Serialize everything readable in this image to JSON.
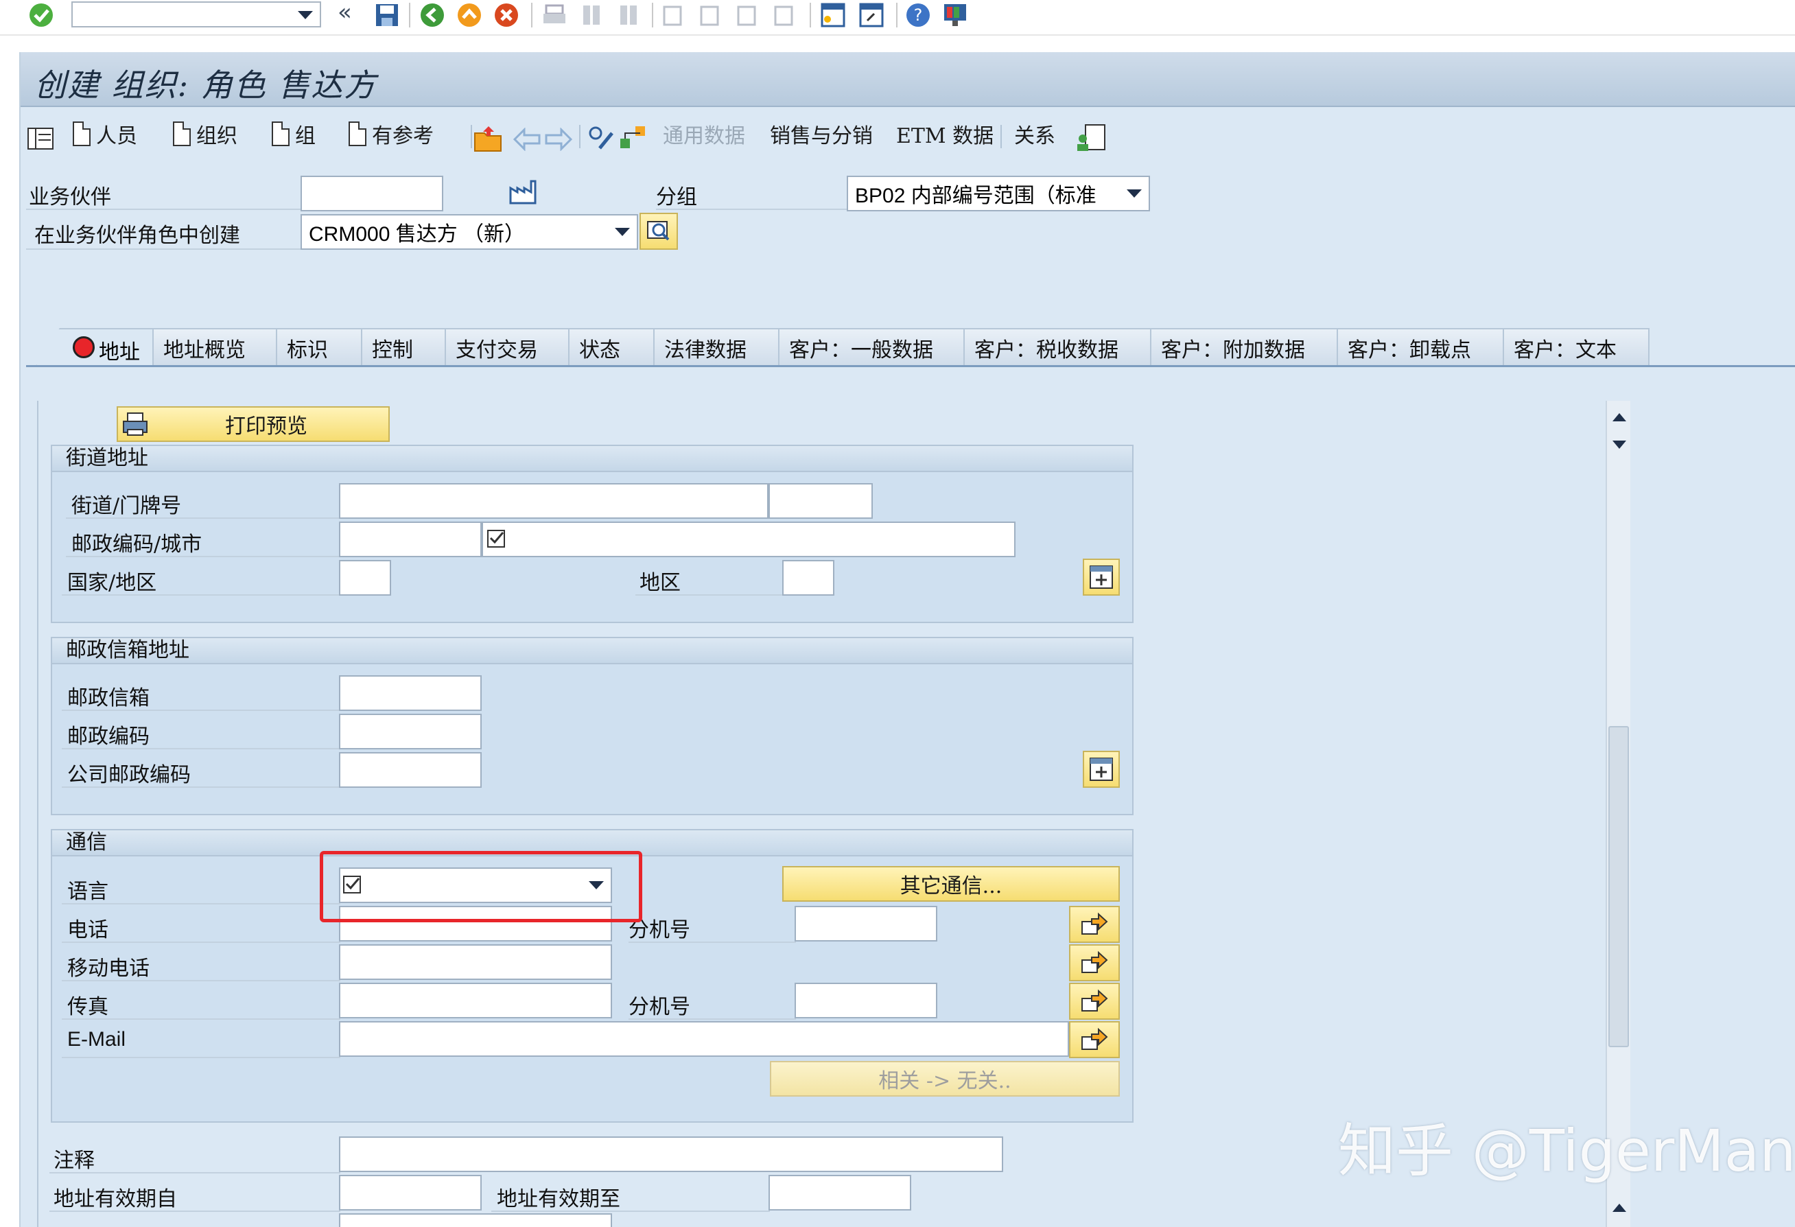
{
  "page_title": "创建 组织: 角色 售达方",
  "app_toolbar": {
    "person": "人员",
    "organization": "组织",
    "group": "组",
    "with_reference": "有参考",
    "general_data": "通用数据",
    "sales_distribution": "销售与分销",
    "etm_data": "ETM 数据",
    "relationships": "关系"
  },
  "header": {
    "business_partner_label": "业务伙伴",
    "business_partner_value": "",
    "grouping_label": "分组",
    "grouping_value": "BP02 内部编号范围（标准",
    "create_in_role_label": "在业务伙伴角色中创建",
    "create_in_role_value": "CRM000 售达方 （新）"
  },
  "tabs": [
    {
      "label": "地址"
    },
    {
      "label": "地址概览"
    },
    {
      "label": "标识"
    },
    {
      "label": "控制"
    },
    {
      "label": "支付交易"
    },
    {
      "label": "状态"
    },
    {
      "label": "法律数据"
    },
    {
      "label": "客户：一般数据"
    },
    {
      "label": "客户：税收数据"
    },
    {
      "label": "客户：附加数据"
    },
    {
      "label": "客户：卸载点"
    },
    {
      "label": "客户：文本"
    }
  ],
  "print_preview": "打印预览",
  "street_address": {
    "title": "街道地址",
    "street_label": "街道/门牌号",
    "postal_city_label": "邮政编码/城市",
    "country_label": "国家/地区",
    "region_label": "地区"
  },
  "po_box_address": {
    "title": "邮政信箱地址",
    "po_box_label": "邮政信箱",
    "postal_code_label": "邮政编码",
    "company_postal_code_label": "公司邮政编码"
  },
  "communication": {
    "title": "通信",
    "language_label": "语言",
    "language_value": "",
    "other_comm_button": "其它通信...",
    "phone_label": "电话",
    "extension_label": "分机号",
    "mobile_label": "移动电话",
    "fax_label": "传真",
    "fax_extension_label": "分机号",
    "email_label": "E-Mail",
    "relevant_button": "相关 -> 无关.."
  },
  "notes_label": "注释",
  "valid_from_label": "地址有效期自",
  "valid_to_label": "地址有效期至",
  "watermark": "知乎 @TigerMan",
  "colors": {
    "background": "#dbe8f4",
    "highlight_box": "#e8252a",
    "button_yellow": "#f6dd72"
  }
}
